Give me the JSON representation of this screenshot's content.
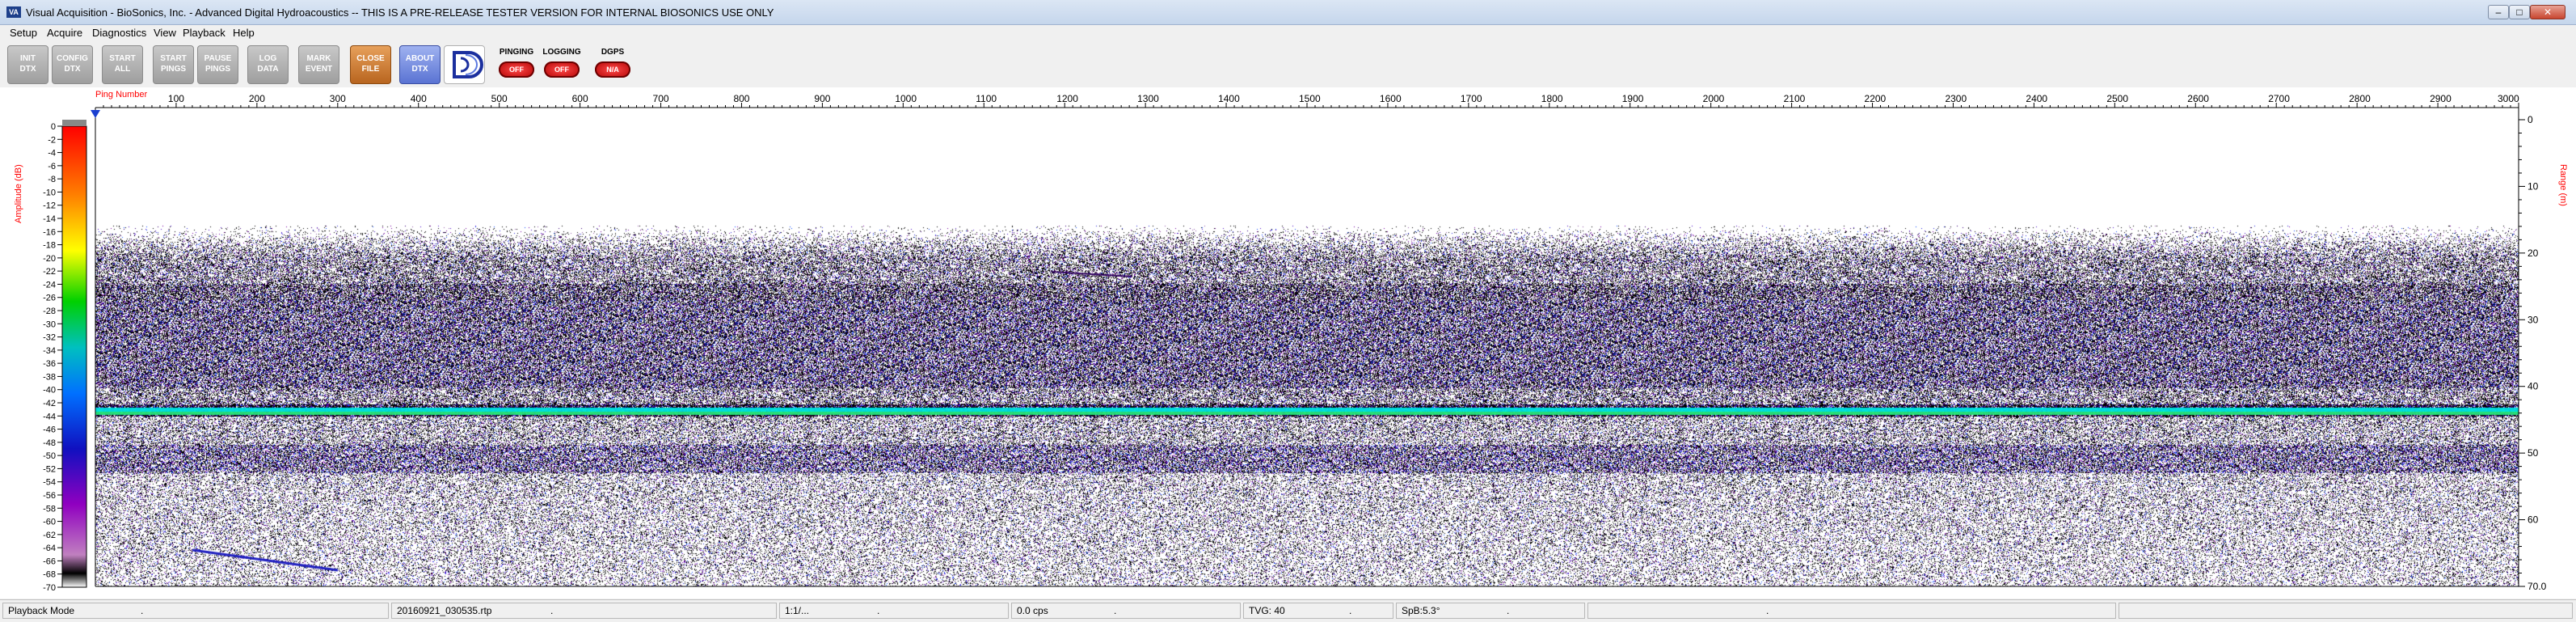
{
  "window": {
    "app_icon_text": "VA",
    "title": "Visual Acquisition  -  BioSonics, Inc.  -  Advanced Digital Hydroacoustics  -- THIS IS A PRE-RELEASE TESTER VERSION FOR INTERNAL BIOSONICS USE ONLY",
    "minimize_glyph": "–",
    "maximize_glyph": "□",
    "close_glyph": "✕"
  },
  "menu": [
    "Setup",
    "Acquire",
    "Diagnostics",
    "View",
    "Playback",
    "Help"
  ],
  "toolbar": {
    "buttons": [
      {
        "line1": "INIT",
        "line2": "DTX"
      },
      {
        "line1": "CONFIG",
        "line2": "DTX"
      },
      {
        "line1": "START",
        "line2": "ALL"
      },
      {
        "line1": "START",
        "line2": "PINGS"
      },
      {
        "line1": "PAUSE",
        "line2": "PINGS"
      },
      {
        "line1": "LOG",
        "line2": "DATA"
      },
      {
        "line1": "MARK",
        "line2": "EVENT"
      },
      {
        "line1": "CLOSE",
        "line2": "FILE"
      },
      {
        "line1": "ABOUT",
        "line2": "DTX"
      }
    ],
    "logo_icon": "biosonics-logo-icon",
    "toggles": [
      {
        "label": "PINGING",
        "state": "OFF"
      },
      {
        "label": "LOGGING",
        "state": "OFF"
      },
      {
        "label": "DGPS",
        "state": "N/A"
      }
    ]
  },
  "plot": {
    "x_axis_title": "Ping Number",
    "left_axis_title": "Amplitude (dB)",
    "right_axis_title": "Range (m)",
    "x_ticks": [
      "100",
      "200",
      "300",
      "400",
      "500",
      "600",
      "700",
      "800",
      "900",
      "1000",
      "1100",
      "1200",
      "1300",
      "1400",
      "1500",
      "1600",
      "1700",
      "1800",
      "1900",
      "2000",
      "2100",
      "2200",
      "2300",
      "2400",
      "2500",
      "2600",
      "2700",
      "2800",
      "2900",
      "3000"
    ],
    "amp_ticks": [
      "0",
      "-2",
      "-4",
      "-6",
      "-8",
      "-10",
      "-12",
      "-14",
      "-16",
      "-18",
      "-20",
      "-22",
      "-24",
      "-26",
      "-28",
      "-30",
      "-32",
      "-34",
      "-36",
      "-38",
      "-40",
      "-42",
      "-44",
      "-46",
      "-48",
      "-50",
      "-52",
      "-54",
      "-56",
      "-58",
      "-60",
      "-62",
      "-64",
      "-66",
      "-68",
      "-70"
    ],
    "range_ticks": [
      "0",
      "10",
      "20",
      "30",
      "40",
      "50",
      "60",
      "70.0"
    ],
    "colors": {
      "axis_label": "#ff0000",
      "bottom_line": "#00c8c8"
    }
  },
  "status": [
    {
      "text": "Playback Mode",
      "sep": "."
    },
    {
      "text": "20160921_030535.rtp",
      "sep": "."
    },
    {
      "text": "1:1/...",
      "sep": "."
    },
    {
      "text": "0.0 cps",
      "sep": "."
    },
    {
      "text": "TVG: 40",
      "sep": "."
    },
    {
      "text": "SpB:5.3°",
      "sep": "."
    },
    {
      "text": "",
      "sep": "."
    },
    {
      "text": "",
      "sep": ""
    }
  ]
}
